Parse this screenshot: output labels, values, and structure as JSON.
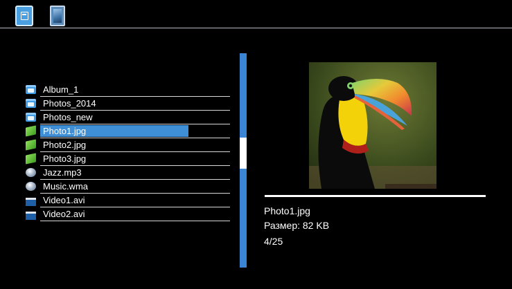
{
  "toolbar": {
    "tabs": [
      {
        "icon": "folder-icon",
        "active": true
      },
      {
        "icon": "photo-icon",
        "active": false
      }
    ]
  },
  "file_list": {
    "items": [
      {
        "name": "Album_1",
        "type": "folder",
        "icon": "folder-icon"
      },
      {
        "name": "Photos_2014",
        "type": "folder",
        "icon": "folder-icon"
      },
      {
        "name": "Photos_new",
        "type": "folder",
        "icon": "folder-icon"
      },
      {
        "name": "Photo1.jpg",
        "type": "photo",
        "icon": "photo-icon",
        "selected": true
      },
      {
        "name": "Photo2.jpg",
        "type": "photo",
        "icon": "photo-icon"
      },
      {
        "name": "Photo3.jpg",
        "type": "photo",
        "icon": "photo-icon"
      },
      {
        "name": "Jazz.mp3",
        "type": "music",
        "icon": "music-icon"
      },
      {
        "name": "Music.wma",
        "type": "music",
        "icon": "music-icon"
      },
      {
        "name": "Video1.avi",
        "type": "video",
        "icon": "video-icon"
      },
      {
        "name": "Video2.avi",
        "type": "video",
        "icon": "video-icon"
      }
    ]
  },
  "scrollbar": {
    "position": 0.4
  },
  "preview": {
    "image": "toucan-photo",
    "file_name": "Photo1.jpg",
    "size_text": "Размер: 82 KB",
    "index_text": "4/25"
  },
  "colors": {
    "background": "#000000",
    "accent": "#3f8fd6",
    "text": "#ffffff"
  }
}
